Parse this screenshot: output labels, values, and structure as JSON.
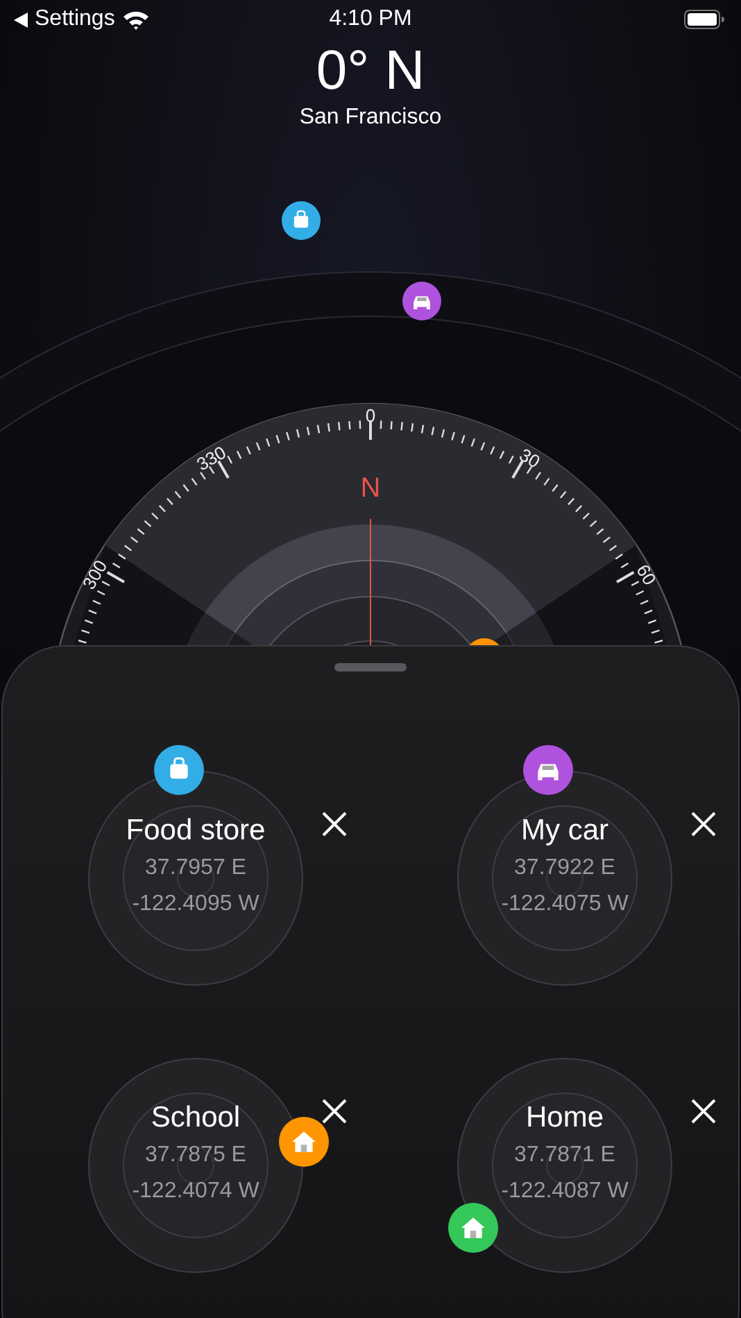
{
  "status_bar": {
    "back_label": "Settings",
    "time": "4:10 PM"
  },
  "heading": {
    "bearing": "0° N",
    "city": "San Francisco"
  },
  "compass": {
    "north_label": "N",
    "dial_labels": [
      "0",
      "30",
      "60",
      "300",
      "330"
    ],
    "markers": [
      {
        "kind": "bag",
        "color": "#32ade6"
      },
      {
        "kind": "car",
        "color": "#af52de"
      },
      {
        "color": "#ff9500"
      }
    ]
  },
  "places": [
    {
      "name": "Food store",
      "lat": "37.7957 E",
      "lon": "-122.4095 W",
      "kind": "bag",
      "color": "#32ade6"
    },
    {
      "name": "My car",
      "lat": "37.7922 E",
      "lon": "-122.4075 W",
      "kind": "car",
      "color": "#af52de"
    },
    {
      "name": "School",
      "lat": "37.7875 E",
      "lon": "-122.4074 W",
      "kind": "house",
      "color": "#ff9500"
    },
    {
      "name": "Home",
      "lat": "37.7871 E",
      "lon": "-122.4087 W",
      "kind": "house",
      "color": "#34c759"
    }
  ]
}
